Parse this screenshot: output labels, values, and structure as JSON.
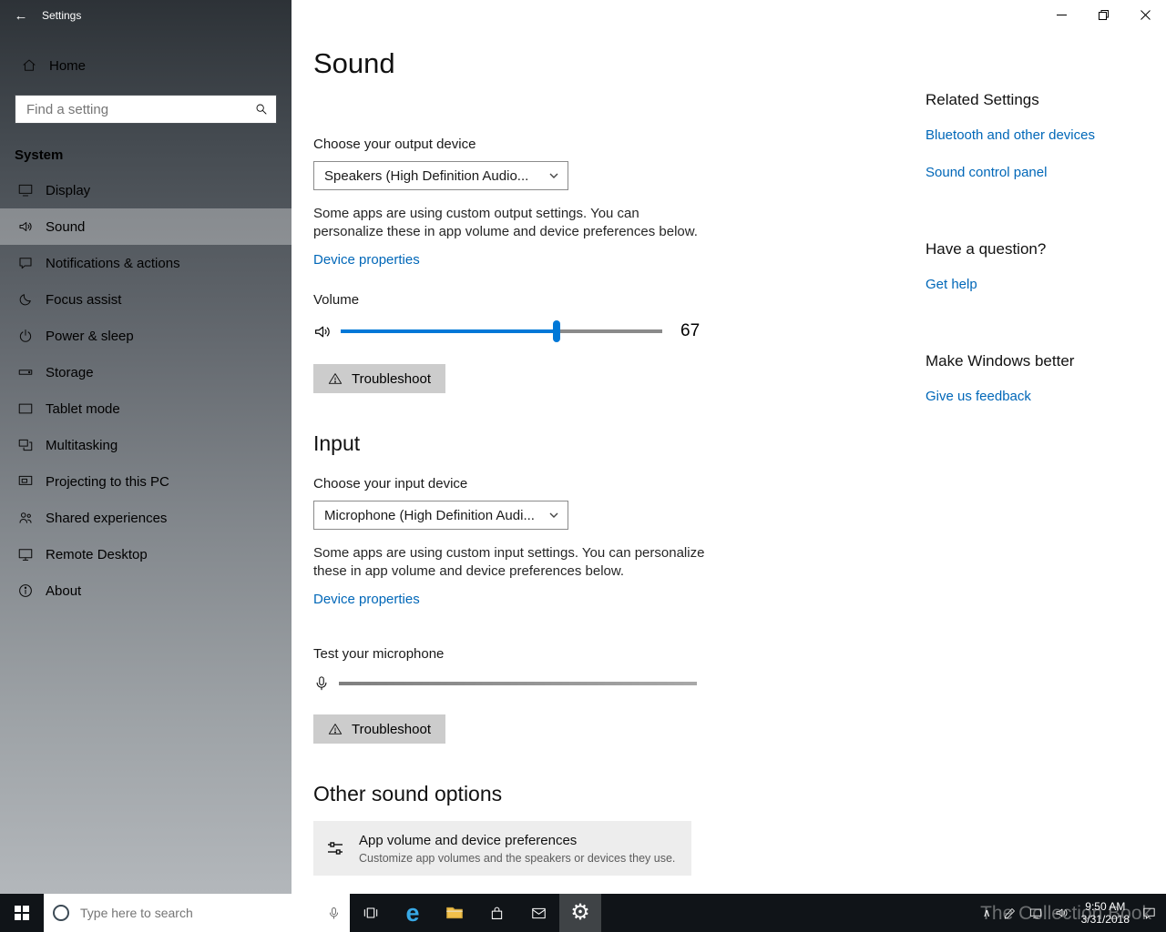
{
  "window": {
    "app_title": "Settings"
  },
  "sidebar": {
    "back_glyph": "←",
    "title": "Settings",
    "home_label": "Home",
    "search_placeholder": "Find a setting",
    "section_header": "System",
    "items": [
      {
        "label": "Display"
      },
      {
        "label": "Sound",
        "selected": true
      },
      {
        "label": "Notifications & actions"
      },
      {
        "label": "Focus assist"
      },
      {
        "label": "Power & sleep"
      },
      {
        "label": "Storage"
      },
      {
        "label": "Tablet mode"
      },
      {
        "label": "Multitasking"
      },
      {
        "label": "Projecting to this PC"
      },
      {
        "label": "Shared experiences"
      },
      {
        "label": "Remote Desktop"
      },
      {
        "label": "About"
      }
    ]
  },
  "main": {
    "page_title": "Sound",
    "output": {
      "label": "Choose your output device",
      "selected_device": "Speakers (High Definition Audio...",
      "note": "Some apps are using custom output settings. You can personalize these in app volume and device preferences below.",
      "device_properties_link": "Device properties",
      "volume_label": "Volume",
      "volume_value": "67",
      "troubleshoot_label": "Troubleshoot"
    },
    "input": {
      "heading": "Input",
      "label": "Choose your input device",
      "selected_device": "Microphone (High Definition Audi...",
      "note": "Some apps are using custom input settings. You can personalize these in app volume and device preferences below.",
      "device_properties_link": "Device properties",
      "test_label": "Test your microphone",
      "troubleshoot_label": "Troubleshoot"
    },
    "other": {
      "heading": "Other sound options",
      "app_volume_title": "App volume and device preferences",
      "app_volume_subtitle": "Customize app volumes and the speakers or devices they use."
    }
  },
  "related": {
    "heading": "Related Settings",
    "bluetooth_link": "Bluetooth and other devices",
    "sound_control_link": "Sound control panel",
    "question_heading": "Have a question?",
    "get_help_link": "Get help",
    "better_heading": "Make Windows better",
    "feedback_link": "Give us feedback"
  },
  "taskbar": {
    "search_placeholder": "Type here to search",
    "edge_glyph": "e",
    "gear_glyph": "⚙",
    "tray_chevron": "∧",
    "clock_time": "9:50 AM",
    "clock_date": "3/31/2018",
    "watermark": "The Collection Book"
  },
  "colors": {
    "accent": "#0078d7",
    "link_blue": "#0067b8",
    "taskbar_bg": "#101418"
  }
}
